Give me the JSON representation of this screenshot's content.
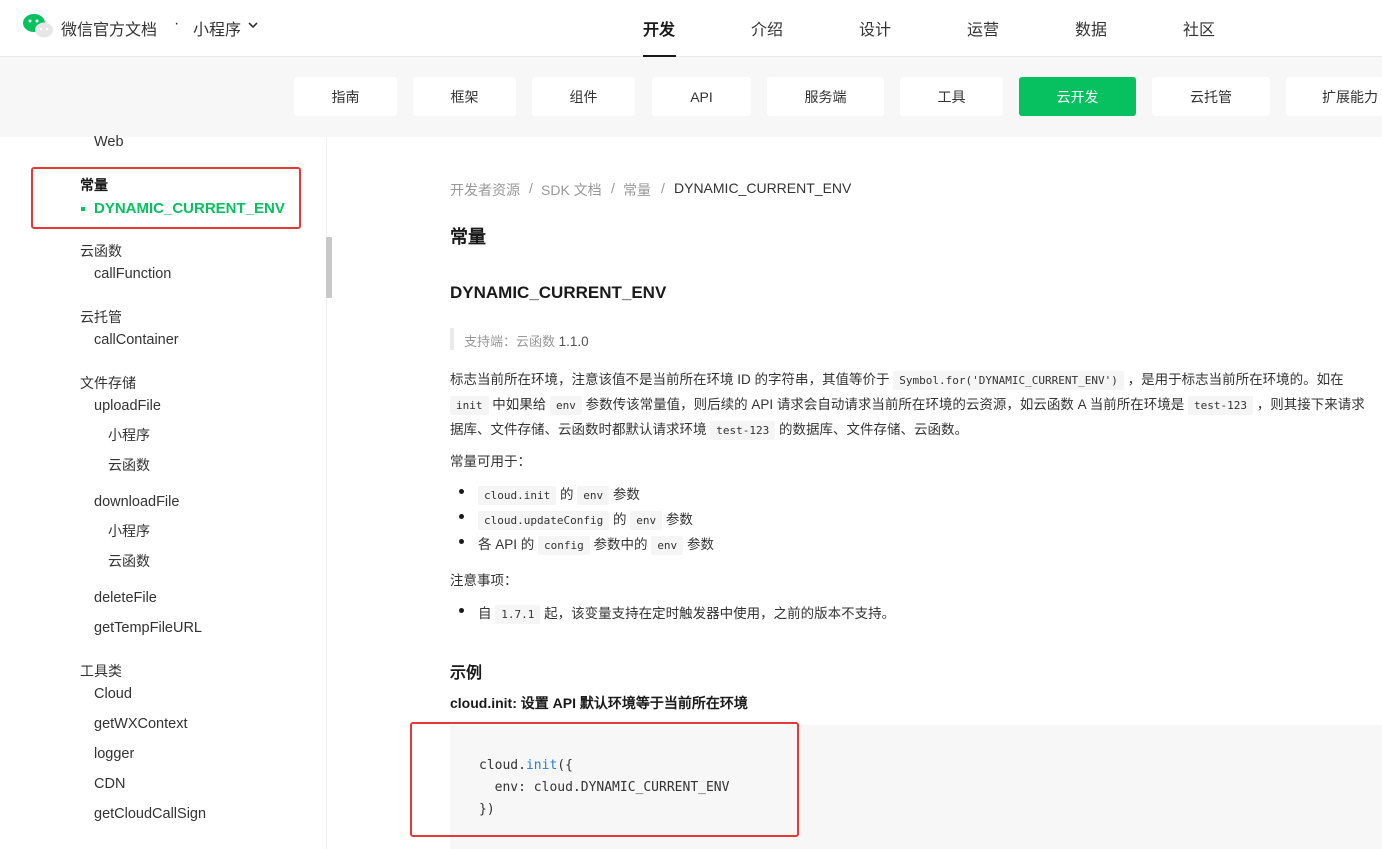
{
  "header": {
    "brand": "微信官方文档",
    "dot": "·",
    "product": "小程序",
    "nav": [
      "开发",
      "介绍",
      "设计",
      "运营",
      "数据",
      "社区"
    ],
    "active_nav": "开发"
  },
  "subnav": {
    "items": [
      "指南",
      "框架",
      "组件",
      "API",
      "服务端",
      "工具",
      "云开发",
      "云托管",
      "扩展能力"
    ],
    "active": "云开发"
  },
  "sidebar": {
    "web": "Web",
    "const_group": "常量",
    "const_active": "DYNAMIC_CURRENT_ENV",
    "func_group": "云函数",
    "call_function": "callFunction",
    "container_group": "云托管",
    "call_container": "callContainer",
    "storage_group": "文件存储",
    "upload_file": "uploadFile",
    "upload_mp": "小程序",
    "upload_cf": "云函数",
    "download_file": "downloadFile",
    "download_mp": "小程序",
    "download_cf": "云函数",
    "delete_file": "deleteFile",
    "get_temp": "getTempFileURL",
    "tools_group": "工具类",
    "cloud": "Cloud",
    "get_wx_context": "getWXContext",
    "logger": "logger",
    "cdn": "CDN",
    "get_cloud_call_sign": "getCloudCallSign"
  },
  "breadcrumb": {
    "items": [
      "开发者资源",
      "SDK 文档",
      "常量",
      "DYNAMIC_CURRENT_ENV"
    ],
    "sep": "/"
  },
  "content": {
    "title": "常量",
    "subtitle": "DYNAMIC_CURRENT_ENV",
    "support_label": "支持端：云函数",
    "support_version": "1.1.0",
    "p1_a": "标志当前所在环境，注意该值不是当前所在环境 ID 的字符串，其值等价于",
    "p1_code": "Symbol.for('DYNAMIC_CURRENT_ENV')",
    "p1_b": "，是用于标志当前所在环境的。如在",
    "p2_code1": "init",
    "p2_a": "中如果给",
    "p2_code2": "env",
    "p2_b": "参数传该常量值，则后续的 API 请求会自动请求当前所在环境的云资源，如云函数 A 当前所在环境是",
    "p2_code3": "test-123",
    "p2_c": "，则其接下来请求",
    "p3_a": "据库、文件存储、云函数时都默认请求环境",
    "p3_code": "test-123",
    "p3_b": "的数据库、文件存储、云函数。",
    "usable_label": "常量可用于：",
    "use1_code1": "cloud.init",
    "use1_a": "的",
    "use1_code2": "env",
    "use1_b": "参数",
    "use2_code1": "cloud.updateConfig",
    "use2_a": "的",
    "use2_code2": "env",
    "use2_b": "参数",
    "use3_a": "各 API 的",
    "use3_code1": "config",
    "use3_b": "参数中的",
    "use3_code2": "env",
    "use3_c": "参数",
    "notes_label": "注意事项：",
    "note1_a": "自",
    "note1_code": "1.7.1",
    "note1_b": "起，该变量支持在定时触发器中使用，之前的版本不支持。",
    "example_title": "示例",
    "example_sub": "cloud.init: 设置 API 默认环境等于当前所在环境",
    "code_l1_a": "cloud.",
    "code_l1_fn": "init",
    "code_l1_b": "({",
    "code_l2": "  env: cloud.DYNAMIC_CURRENT_ENV",
    "code_l3": "})"
  },
  "colors": {
    "accent": "#07c160",
    "annotation": "#e53935"
  }
}
